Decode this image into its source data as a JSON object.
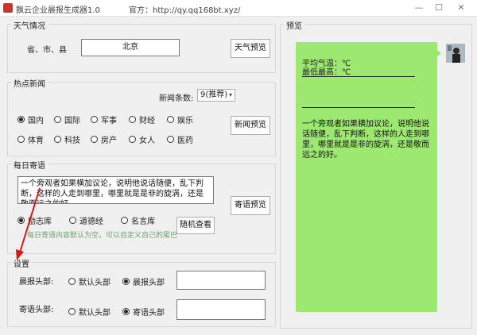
{
  "window": {
    "title": "飘云企业晨报生成器1.0",
    "site": "官方：http://qy.qq168bt.xyz/"
  },
  "weather": {
    "group_title": "天气情况",
    "region_label": "省、市、县",
    "city_value": "北京",
    "preview_button": "天气预览"
  },
  "news": {
    "group_title": "热点新闻",
    "count_label": "新闻条数:",
    "count_value": "9(推荐)",
    "categories": [
      {
        "label": "国内",
        "checked": true
      },
      {
        "label": "国际",
        "checked": false
      },
      {
        "label": "军事",
        "checked": false
      },
      {
        "label": "财经",
        "checked": false
      },
      {
        "label": "娱乐",
        "checked": false
      },
      {
        "label": "体育",
        "checked": false
      },
      {
        "label": "科技",
        "checked": false
      },
      {
        "label": "房产",
        "checked": false
      },
      {
        "label": "女人",
        "checked": false
      },
      {
        "label": "医药",
        "checked": false
      }
    ],
    "preview_button": "新闻预览"
  },
  "quote": {
    "group_title": "每日寄语",
    "text": "一个旁观者如果横加议论，说明他说话随便，乱下判断，这样的人走到哪里，哪里就是是非的旋涡，还是敬而远之的好。",
    "sources": [
      {
        "label": "励志库",
        "checked": true
      },
      {
        "label": "道德经",
        "checked": false
      },
      {
        "label": "名言库",
        "checked": false
      }
    ],
    "random_button": "随机查看",
    "preview_button": "寄语预览",
    "hint": "每日寄语内容默认为空，可以自定义自己的尾巴"
  },
  "settings": {
    "group_title": "设置",
    "morning": {
      "label": "晨报头部:",
      "options": [
        {
          "label": "默认头部",
          "checked": false
        },
        {
          "label": "晨报头部",
          "checked": true
        }
      ],
      "value": ""
    },
    "quote": {
      "label": "寄语头部:",
      "options": [
        {
          "label": "默认头部",
          "checked": false
        },
        {
          "label": "寄语头部",
          "checked": true
        }
      ],
      "value": ""
    }
  },
  "preview": {
    "group_title": "预览",
    "avg_temp": "平均气温：℃",
    "max_temp": "最低最高：℃",
    "quote": "一个旁观者如果横加议论，说明他说话随便，乱下判断，这样的人走到哪里，哪里就是是非的旋涡，还是敬而远之的好。"
  },
  "colors": {
    "bubble": "#9de871",
    "hint": "#6aa36a",
    "arrow": "#d11a1a"
  }
}
